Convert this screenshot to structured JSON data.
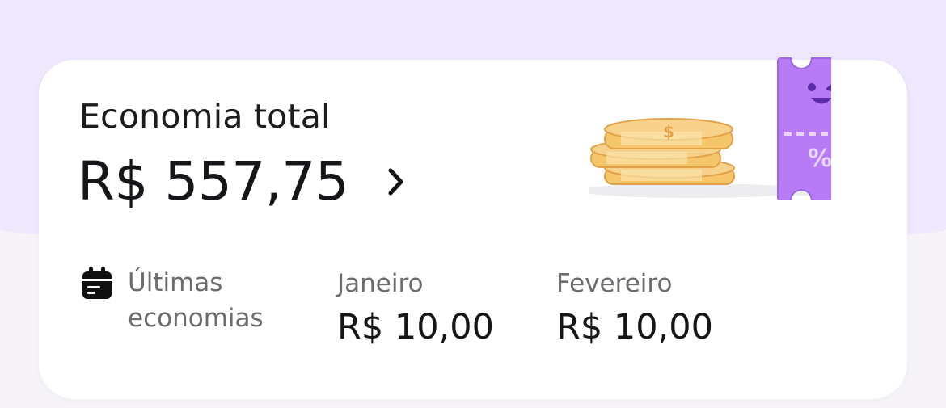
{
  "header": {
    "title": "Economia total",
    "total": "R$ 557,75"
  },
  "last_savings": {
    "label": "Últimas economias",
    "months": [
      {
        "name": "Janeiro",
        "value": "R$ 10,00"
      },
      {
        "name": "Fevereiro",
        "value": "R$ 10,00"
      }
    ]
  },
  "illustration": {
    "coin_symbol": "$",
    "ticket_symbol": "%"
  },
  "colors": {
    "background_top": "#efe7fc",
    "card": "#ffffff",
    "ticket_purple": "#b77cf5",
    "coin_gold": "#f6c66b",
    "text_primary": "#16161a",
    "text_secondary": "#6b6b70"
  }
}
